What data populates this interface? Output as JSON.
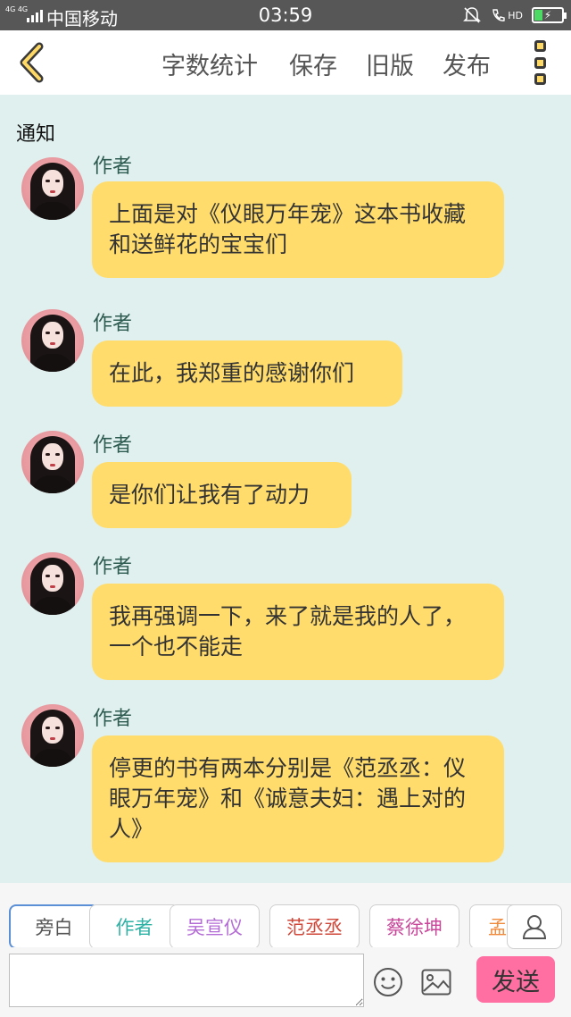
{
  "status_bar": {
    "network": "4G 4G",
    "carrier": "中国移动",
    "time": "03:59",
    "hd_label": "HD"
  },
  "toolbar": {
    "word_count_label": "字数统计",
    "save_label": "保存",
    "old_version_label": "旧版",
    "publish_label": "发布"
  },
  "notice_label": "通知",
  "messages": [
    {
      "sender": "作者",
      "text": "上面是对《仪眼万年宠》这本书收藏和送鲜花的宝宝们"
    },
    {
      "sender": "作者",
      "text": "在此，我郑重的感谢你们"
    },
    {
      "sender": "作者",
      "text": "是你们让我有了动力"
    },
    {
      "sender": "作者",
      "text": "我再强调一下，来了就是我的人了，一个也不能走"
    },
    {
      "sender": "作者",
      "text": "停更的书有两本分别是《范丞丞：仪眼万年宠》和《诚意夫妇：遇上对的人》"
    }
  ],
  "roles": [
    {
      "label": "旁白",
      "color": "#555555"
    },
    {
      "label": "作者",
      "color": "#2fb2a6"
    },
    {
      "label": "吴宣仪",
      "color": "#b46cd6"
    },
    {
      "label": "范丞丞",
      "color": "#d0483a"
    },
    {
      "label": "蔡徐坤",
      "color": "#c8479a"
    },
    {
      "label": "孟",
      "color": "#f08a3c"
    }
  ],
  "composer": {
    "input_value": "",
    "send_label": "发送"
  },
  "colors": {
    "bubble": "#ffdc6c",
    "background": "#dff0ee",
    "send_button": "#ff6fa2"
  }
}
